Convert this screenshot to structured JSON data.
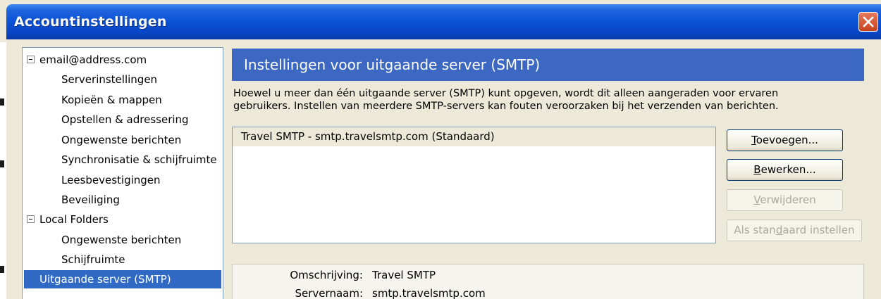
{
  "window": {
    "title": "Accountinstellingen"
  },
  "sidebar": {
    "items": [
      {
        "label": "email@address.com",
        "level": 0,
        "expandable": true
      },
      {
        "label": "Serverinstellingen",
        "level": 1
      },
      {
        "label": "Kopieën & mappen",
        "level": 1
      },
      {
        "label": "Opstellen & adressering",
        "level": 1
      },
      {
        "label": "Ongewenste berichten",
        "level": 1
      },
      {
        "label": "Synchronisatie & schijfruimte",
        "level": 1
      },
      {
        "label": "Leesbevestigingen",
        "level": 1
      },
      {
        "label": "Beveiliging",
        "level": 1
      },
      {
        "label": "Local Folders",
        "level": 0,
        "expandable": true
      },
      {
        "label": "Ongewenste berichten",
        "level": 1
      },
      {
        "label": "Schijfruimte",
        "level": 1
      },
      {
        "label": "Uitgaande server (SMTP)",
        "level": 0,
        "selected": true
      }
    ]
  },
  "main": {
    "header": "Instellingen voor uitgaande server (SMTP)",
    "description_line1": "Hoewel u meer dan één uitgaande server (SMTP) kunt opgeven, wordt dit alleen aangeraden voor ervaren",
    "description_line2": "gebruikers. Instellen van meerdere SMTP-servers kan fouten veroorzaken bij het verzenden van berichten.",
    "servers": [
      "Travel SMTP - smtp.travelsmtp.com (Standaard)"
    ],
    "buttons": {
      "add": {
        "access_key": "T",
        "rest": "oevoegen..."
      },
      "edit": {
        "access_key": "B",
        "rest": "ewerken..."
      },
      "remove": {
        "access_key": "V",
        "rest": "erwijderen"
      },
      "set_default": {
        "before": "Als stan",
        "access_key": "d",
        "after": "aard instellen"
      }
    },
    "details": {
      "description_label": "Omschrijving:",
      "description_value": "Travel SMTP",
      "servername_label": "Servernaam:",
      "servername_value": "smtp.travelsmtp.com"
    }
  },
  "colors": {
    "titlebar": "#0a52d6",
    "header_bg": "#3c68c2",
    "selection": "#316ac5",
    "dialog_bg": "#ece9d8",
    "close_button": "#c7411f"
  }
}
